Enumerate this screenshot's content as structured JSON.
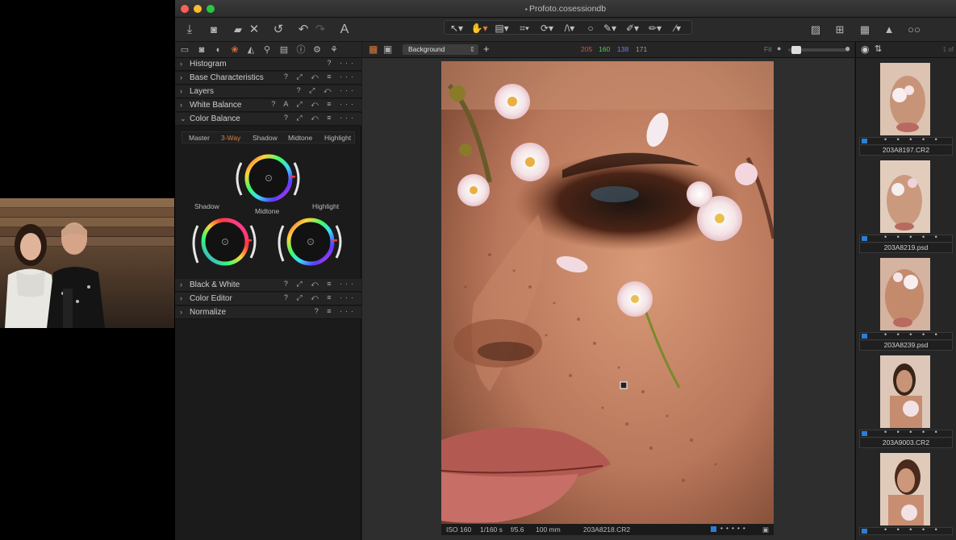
{
  "window": {
    "title": "Profoto.cosessiondb"
  },
  "toolbar": {
    "left_icons": [
      "import-icon",
      "camera-icon",
      "folder-icon",
      "close-icon",
      "undo-icon"
    ],
    "undo_redo": [
      "undo-icon",
      "redo-icon"
    ],
    "text_tool": "A",
    "cursor_tools": [
      "select-arrow-icon",
      "hand-pan-icon",
      "stack-icon",
      "crop-icon",
      "rotate-icon",
      "keystone-icon",
      "circle-mask-icon",
      "brush-icon",
      "eraser-icon",
      "draw-mask-icon",
      "picker-icon"
    ],
    "right_icons": [
      "edit-icon",
      "compare-icon",
      "grid-icon",
      "warning-icon",
      "glasses-icon"
    ]
  },
  "tool_tabs": [
    "folder-icon",
    "camera-icon",
    "lens-icon",
    "color-icon",
    "exposure-icon",
    "search-icon",
    "metadata-icon",
    "info-icon",
    "settings-icon",
    "styles-icon"
  ],
  "panels": [
    {
      "label": "Histogram",
      "expanded": false,
      "controls": "? ···"
    },
    {
      "label": "Base Characteristics",
      "expanded": false,
      "controls": "? ⤢ ↶ ≡ ···"
    },
    {
      "label": "Layers",
      "expanded": false,
      "controls": "? ⤢ ↶ ···"
    },
    {
      "label": "White Balance",
      "expanded": false,
      "controls": "? A ⤢ ↶ ≡ ···"
    },
    {
      "label": "Color Balance",
      "expanded": true,
      "controls": "? ⤢ ↶ ≡ ···"
    },
    {
      "label": "Black & White",
      "expanded": false,
      "controls": "? ⤢ ↶ ≡ ···"
    },
    {
      "label": "Color Editor",
      "expanded": false,
      "controls": "? ⤢ ↶ ≡ ···"
    },
    {
      "label": "Normalize",
      "expanded": false,
      "controls": "? ≡ ···"
    }
  ],
  "color_balance": {
    "tabs": [
      "Master",
      "3-Way",
      "Shadow",
      "Midtone",
      "Highlight"
    ],
    "active_tab": "3-Way",
    "wheels": {
      "shadow": "Shadow",
      "midtone": "Midtone",
      "highlight": "Highlight"
    }
  },
  "viewer": {
    "layer": "Background",
    "rgb": {
      "r": "205",
      "g": "160",
      "b": "138",
      "a": "171"
    },
    "fit": "Fit",
    "meta": {
      "iso": "ISO 160",
      "shutter": "1/160 s",
      "aperture": "f/5.6",
      "focal": "100 mm",
      "file": "203A8218.CR2"
    }
  },
  "browser": {
    "count": "1 of",
    "thumbnails": [
      {
        "name": "203A8197.CR2",
        "rating_dots": "• • • • •"
      },
      {
        "name": "203A8219.psd",
        "rating_dots": "• • • • •"
      },
      {
        "name": "203A8239.psd",
        "rating_dots": "• • • • •"
      },
      {
        "name": "203A9003.CR2",
        "rating_dots": "• • • • •"
      },
      {
        "name": "",
        "rating_dots": "• • • • •"
      }
    ]
  },
  "colors": {
    "accent": "#e07b3c",
    "select_blue": "#2b7ed8",
    "r": "#e0503c",
    "g": "#5fc850",
    "b": "#6f7fe8"
  }
}
